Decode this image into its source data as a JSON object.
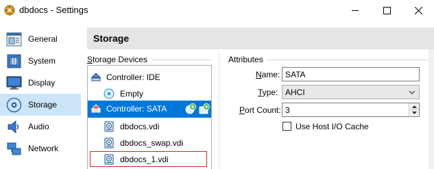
{
  "window": {
    "title": "dbdocs - Settings",
    "icons": [
      "app-icon",
      "minimize-icon",
      "maximize-icon",
      "close-icon"
    ]
  },
  "nav": {
    "items": [
      {
        "label": "General",
        "icon": "general-icon"
      },
      {
        "label": "System",
        "icon": "system-chip-icon"
      },
      {
        "label": "Display",
        "icon": "display-monitor-icon"
      },
      {
        "label": "Storage",
        "icon": "storage-disk-icon",
        "selected": true
      },
      {
        "label": "Audio",
        "icon": "audio-speaker-icon"
      },
      {
        "label": "Network",
        "icon": "network-icon"
      }
    ]
  },
  "content": {
    "title": "Storage"
  },
  "storage_devices": {
    "label": "Storage Devices",
    "tree": [
      {
        "label": "Controller: IDE",
        "type": "controller",
        "icon": "ide-controller-icon"
      },
      {
        "label": "Empty",
        "type": "optical",
        "icon": "optical-disc-icon"
      },
      {
        "label": "Controller: SATA",
        "type": "controller",
        "icon": "sata-controller-icon",
        "selected": true
      },
      {
        "label": "dbdocs.vdi",
        "type": "disk",
        "icon": "hard-disk-icon"
      },
      {
        "label": "dbdocs_swap.vdi",
        "type": "disk",
        "icon": "hard-disk-icon"
      },
      {
        "label": "dbdocs_1.vdi",
        "type": "disk",
        "icon": "hard-disk-icon",
        "highlighted": true
      }
    ],
    "add_buttons": [
      "add-optical-drive-icon",
      "add-hard-disk-icon"
    ]
  },
  "attributes": {
    "label": "Attributes",
    "name_label": "Name:",
    "name_value": "SATA",
    "type_label": "Type:",
    "type_value": "AHCI",
    "port_count_label": "Port Count:",
    "port_count_value": "3",
    "host_cache_label": "Use Host I/O Cache",
    "host_cache_checked": false
  },
  "colors": {
    "selection": "#0078d7",
    "nav_selection": "#cce4f7",
    "header_bg": "#e5e5e5",
    "highlight_border": "#c42b1c"
  }
}
